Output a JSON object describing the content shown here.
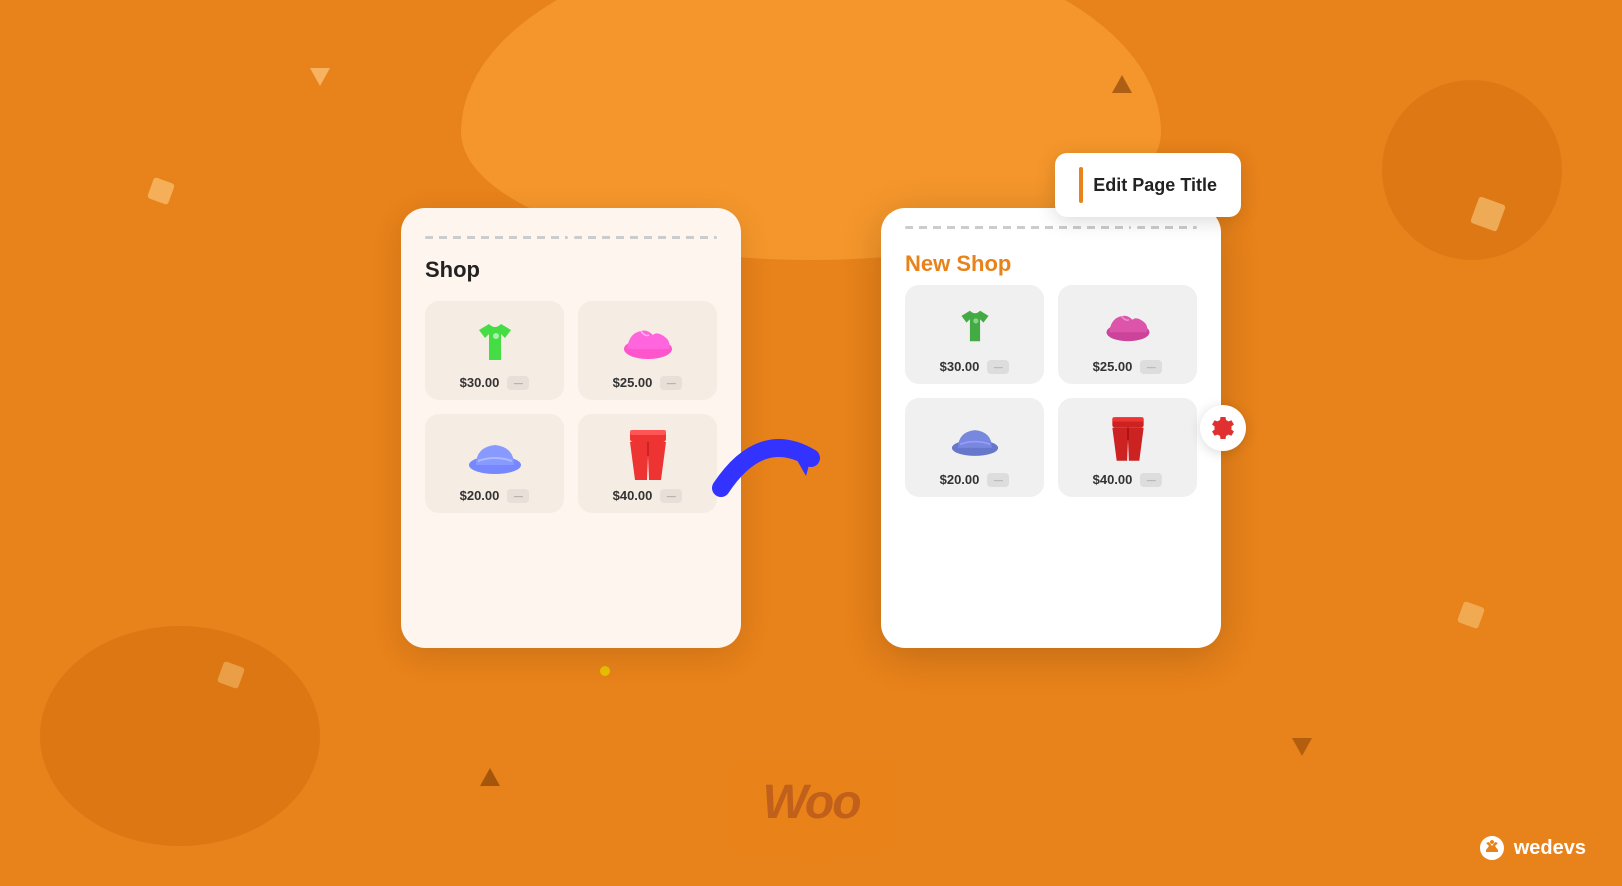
{
  "background": {
    "color": "#E8821A"
  },
  "left_card": {
    "title": "Shop",
    "products": [
      {
        "emoji": "👕",
        "price": "$30.00",
        "color": "green"
      },
      {
        "emoji": "👟",
        "price": "$25.00",
        "color": "pink"
      },
      {
        "emoji": "🧢",
        "price": "$20.00",
        "color": "blue"
      },
      {
        "emoji": "👖",
        "price": "$40.00",
        "color": "red"
      }
    ]
  },
  "right_card": {
    "edit_title_label": "Edit Page Title",
    "title": "New Shop",
    "products": [
      {
        "emoji": "👕",
        "price": "$30.00"
      },
      {
        "emoji": "👟",
        "price": "$25.00"
      },
      {
        "emoji": "🧢",
        "price": "$20.00"
      },
      {
        "emoji": "👖",
        "price": "$40.00"
      }
    ]
  },
  "woo_logo": "Woo",
  "wedevs_logo": "wedevs"
}
